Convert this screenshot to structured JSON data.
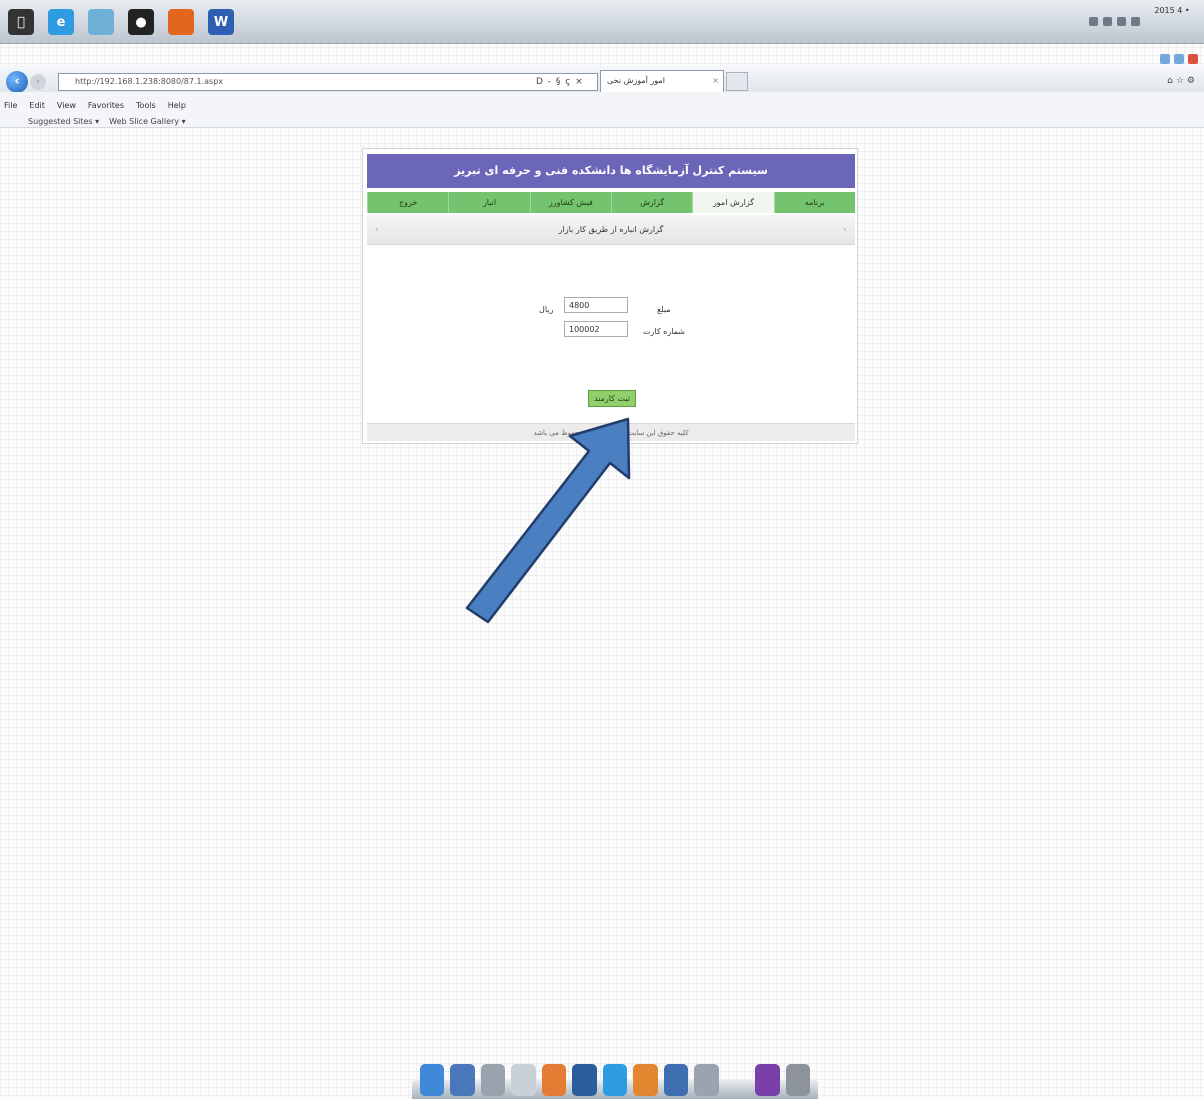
{
  "taskbar": {
    "apps": [
      {
        "name": "apple-icon",
        "color": "#333333",
        "glyph": ""
      },
      {
        "name": "internet-explorer-icon",
        "color": "#2f9be0",
        "glyph": "e"
      },
      {
        "name": "folder-icon",
        "color": "#6fb0d9",
        "glyph": ""
      },
      {
        "name": "media-player-icon",
        "color": "#222222",
        "glyph": "●"
      },
      {
        "name": "firefox-icon",
        "color": "#e2661e",
        "glyph": ""
      },
      {
        "name": "word-icon",
        "color": "#2e5fb2",
        "glyph": "W"
      }
    ],
    "clock": "2015 4 •"
  },
  "browser": {
    "url": "http://192.168.1.238:8080/87.1.aspx",
    "address_controls": "D - § ç ×",
    "tab_title": "امور آموزش نخی",
    "menus": [
      "File",
      "Edit",
      "View",
      "Favorites",
      "Tools",
      "Help"
    ],
    "favorites": [
      "Suggested Sites ▾",
      "Web Slice Gallery ▾"
    ]
  },
  "page": {
    "header_title": "سیستم کنترل آزمایشگاه ها دانشکده فنی و حرفه ای تبریز",
    "nav": [
      "برنامه",
      "گزارش امور",
      "گزارش",
      "فیش کشاورز",
      "انبار",
      "خروج"
    ],
    "active_nav_index": 1,
    "subheader": "گزارش انباره از طریق کار بازار",
    "field1_label": "مبلغ",
    "field1_unit": "ریال",
    "field1_value": "4800",
    "field2_label": "شماره کارت",
    "field2_value": "100002",
    "submit_label": "ثبت کارمند",
    "footer": "کلیه حقوق این سایت برای دانشکده محفوظ می باشد"
  },
  "annotation": {
    "arrow_color": "#4a7fc1",
    "arrow_outline": "#223c6b"
  },
  "dock": {
    "icons": [
      {
        "name": "safari-icon",
        "color": "#3f8ad8"
      },
      {
        "name": "finder-icon",
        "color": "#4a77b9"
      },
      {
        "name": "notes-icon",
        "color": "#9aa3ad"
      },
      {
        "name": "pencil-icon",
        "color": "#c9d0d7"
      },
      {
        "name": "app-store-icon",
        "color": "#e57c33"
      },
      {
        "name": "calculator-icon",
        "color": "#2b5d9c"
      },
      {
        "name": "itunes-icon",
        "color": "#2d9de0"
      },
      {
        "name": "upload-icon",
        "color": "#e2862f"
      },
      {
        "name": "display-icon",
        "color": "#3f6fb1"
      },
      {
        "name": "preview-icon",
        "color": "#9ba4ae"
      },
      {
        "name": "spacer",
        "color": "transparent"
      },
      {
        "name": "photo-booth-icon",
        "color": "#7a3fa8"
      },
      {
        "name": "trash-icon",
        "color": "#8c939b"
      }
    ]
  }
}
